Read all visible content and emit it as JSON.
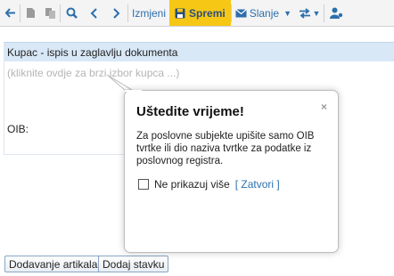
{
  "toolbar": {
    "back_icon": "arrow-left-icon",
    "new_icon": "document-icon",
    "copy_icon": "copy-icon",
    "search_icon": "search-icon",
    "prev_icon": "chevron-left-icon",
    "next_icon": "chevron-right-icon",
    "edit_label": "Izmjeni",
    "save_label": "Spremi",
    "send_label": "Slanje",
    "accent": "#f7c716"
  },
  "section": {
    "header": "Kupac - ispis u zaglavlju dokumenta",
    "placeholder": "(kliknite ovdje za brzi izbor kupca ...)",
    "oib_label": "OIB:"
  },
  "buttons": {
    "add_articles": "Dodavanje artikala",
    "add_item": "Dodaj stavku"
  },
  "popup": {
    "title": "Uštedite vrijeme!",
    "close_glyph": "×",
    "body": "Za poslovne subjekte upišite samo OIB tvrtke ili dio naziva tvrtke za podatke iz poslovnog registra.",
    "checkbox_label": "Ne prikazuj više",
    "close_link": "[ Zatvori ]"
  }
}
